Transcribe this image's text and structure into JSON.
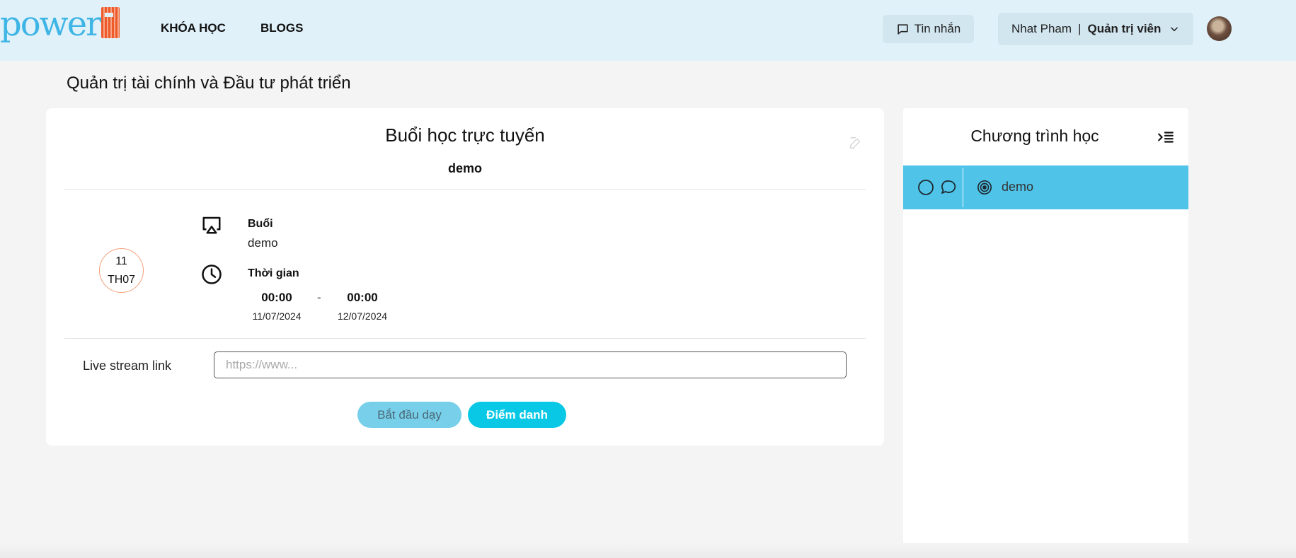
{
  "header": {
    "logo_text": "power",
    "nav": [
      {
        "label": "KHÓA HỌC"
      },
      {
        "label": "BLOGS"
      }
    ],
    "messages_label": "Tin nhắn",
    "user": {
      "name": "Nhat Pham",
      "separator": "|",
      "role": "Quản trị viên"
    }
  },
  "page": {
    "title": "Quản trị tài chính và Đầu tư phát triển"
  },
  "session": {
    "title": "Buổi học trực tuyến",
    "subtitle": "demo",
    "date_badge": {
      "day": "11",
      "month": "TH07"
    },
    "session_label": "Buổi",
    "session_value": "demo",
    "time_label": "Thời gian",
    "start_time": "00:00",
    "end_time": "00:00",
    "separator": "-",
    "start_date": "11/07/2024",
    "end_date": "12/07/2024"
  },
  "livestream": {
    "label": "Live stream link",
    "value": "",
    "placeholder": "https://www..."
  },
  "actions": {
    "start_label": "Bắt đầu dạy",
    "attendance_label": "Điểm danh"
  },
  "sidebar": {
    "title": "Chương trình học",
    "items": [
      {
        "label": "demo"
      }
    ]
  },
  "colors": {
    "header_bg": "#e0f1f9",
    "accent": "#08c8e6",
    "selected_row": "#4fc3e8",
    "logo_blue": "#3fb5e5",
    "logo_orange": "#ee5a2a"
  }
}
